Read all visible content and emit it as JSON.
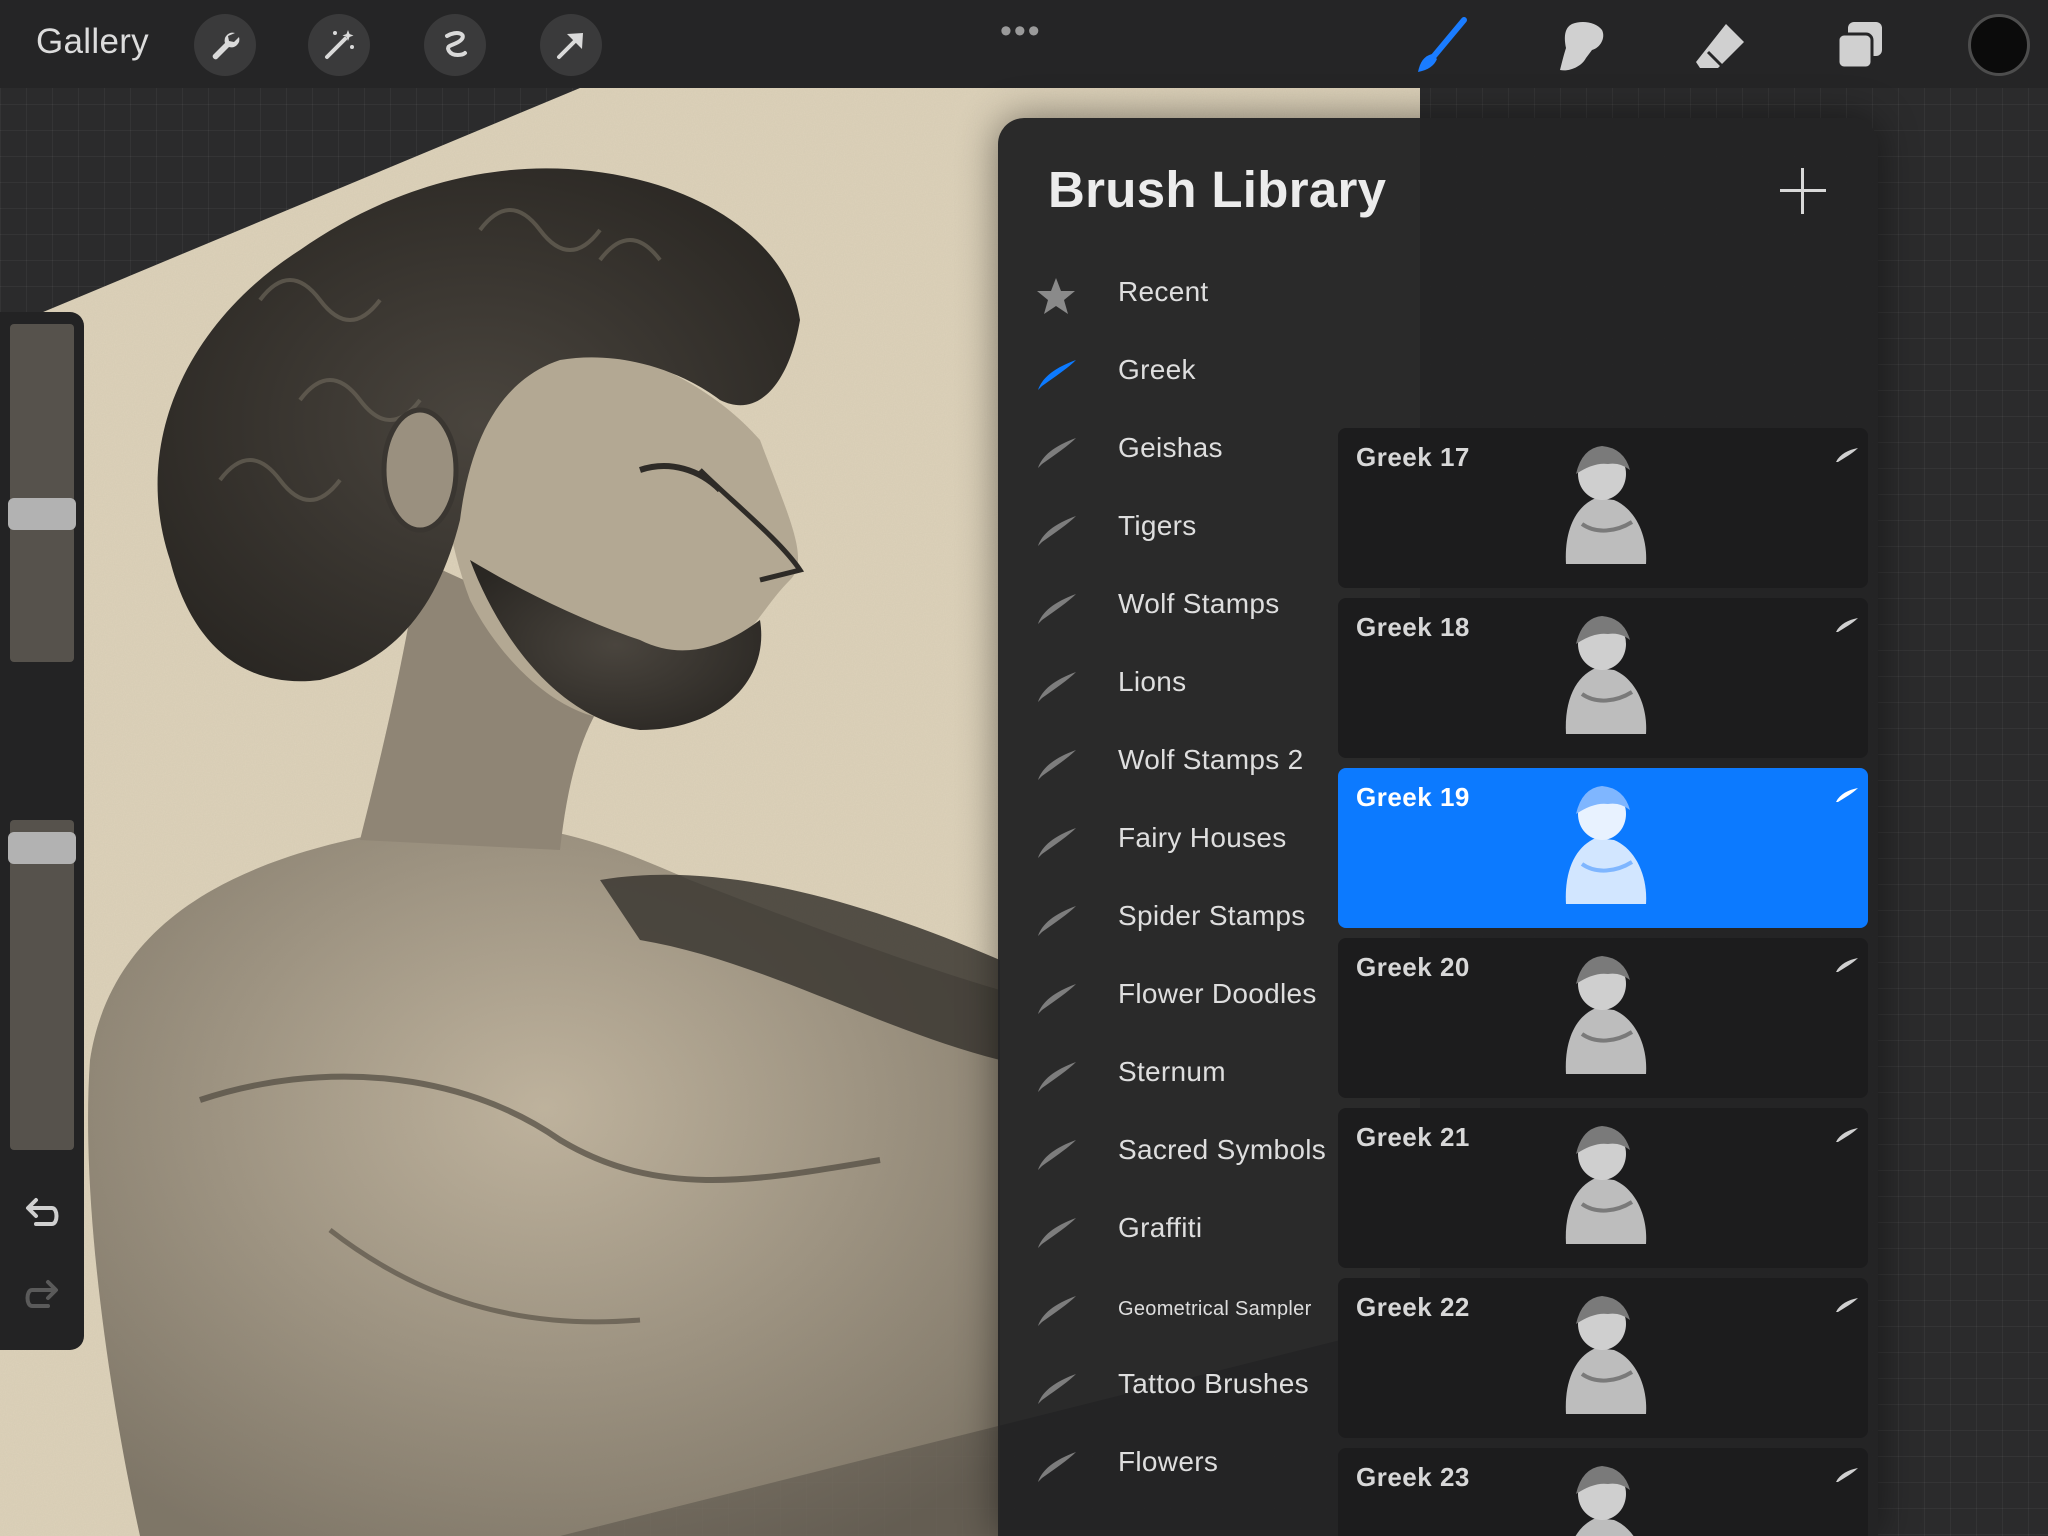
{
  "topbar": {
    "gallery_label": "Gallery",
    "left_tools": [
      "wrench-icon",
      "magic-wand-icon",
      "selection-icon",
      "transform-arrow-icon"
    ],
    "more_label": "•••",
    "right_tools": [
      "brush-icon",
      "smudge-icon",
      "eraser-icon",
      "layers-icon"
    ],
    "active_tool": "brush-icon",
    "current_color": "#0b0b0b"
  },
  "sidebar": {
    "brush_size_level": 0.43,
    "opacity_level": 0.96,
    "icons": [
      "modify-square-icon",
      "undo-icon",
      "redo-icon"
    ]
  },
  "panel": {
    "title": "Brush Library",
    "sets": [
      {
        "label": "Recent",
        "icon": "star-icon"
      },
      {
        "label": "Greek",
        "icon": "brush-stroke-icon",
        "active": true
      },
      {
        "label": "Geishas",
        "icon": "brush-stroke-icon"
      },
      {
        "label": "Tigers",
        "icon": "brush-stroke-icon"
      },
      {
        "label": "Wolf Stamps",
        "icon": "brush-stroke-icon"
      },
      {
        "label": "Lions",
        "icon": "brush-stroke-icon"
      },
      {
        "label": "Wolf Stamps 2",
        "icon": "brush-stroke-icon"
      },
      {
        "label": "Fairy Houses",
        "icon": "brush-stroke-icon"
      },
      {
        "label": "Spider Stamps",
        "icon": "brush-stroke-icon"
      },
      {
        "label": "Flower Doodles",
        "icon": "brush-stroke-icon"
      },
      {
        "label": "Sternum",
        "icon": "brush-stroke-icon"
      },
      {
        "label": "Sacred Symbols",
        "icon": "brush-stroke-icon"
      },
      {
        "label": "Graffiti",
        "icon": "brush-stroke-icon"
      },
      {
        "label": "Geometrical Sampler",
        "icon": "brush-stroke-icon"
      },
      {
        "label": "Tattoo Brushes",
        "icon": "brush-stroke-icon"
      },
      {
        "label": "Flowers",
        "icon": "brush-stroke-icon"
      }
    ],
    "brushes": [
      {
        "name": "",
        "partial": true
      },
      {
        "name": "Greek 17"
      },
      {
        "name": "Greek 18"
      },
      {
        "name": "Greek 19",
        "selected": true
      },
      {
        "name": "Greek 20"
      },
      {
        "name": "Greek 21"
      },
      {
        "name": "Greek 22"
      },
      {
        "name": "Greek 23"
      }
    ],
    "accent_color": "#0c7aff"
  }
}
